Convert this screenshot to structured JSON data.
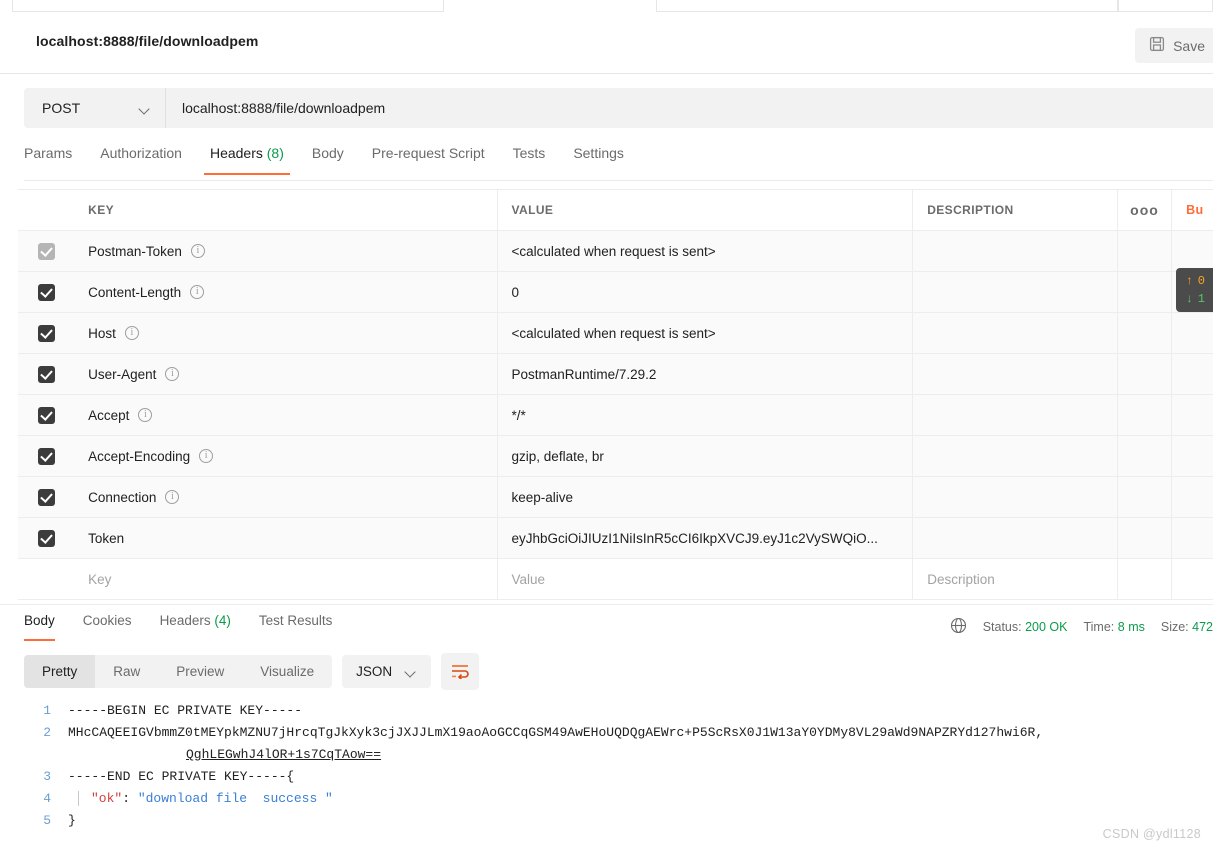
{
  "window": {
    "request_name": "localhost:8888/file/downloadpem",
    "save_label": "Save",
    "save_icon": "floppy-disk-icon"
  },
  "request": {
    "method": "POST",
    "url": "localhost:8888/file/downloadpem",
    "tabs": [
      {
        "label": "Params",
        "count": "",
        "active": false
      },
      {
        "label": "Authorization",
        "count": "",
        "active": false
      },
      {
        "label": "Headers",
        "count": "(8)",
        "active": true
      },
      {
        "label": "Body",
        "count": "",
        "active": false
      },
      {
        "label": "Pre-request Script",
        "count": "",
        "active": false
      },
      {
        "label": "Tests",
        "count": "",
        "active": false
      },
      {
        "label": "Settings",
        "count": "",
        "active": false
      }
    ]
  },
  "headers_table": {
    "columns": {
      "key": "KEY",
      "value": "VALUE",
      "description": "DESCRIPTION",
      "more_icon": "ooo",
      "bulk_edit": "Bu"
    },
    "placeholders": {
      "key": "Key",
      "value": "Value",
      "description": "Description"
    },
    "rows": [
      {
        "checked": true,
        "disabled": true,
        "key": "Postman-Token",
        "info": true,
        "value": "<calculated when request is sent>",
        "description": ""
      },
      {
        "checked": true,
        "disabled": false,
        "key": "Content-Length",
        "info": true,
        "value": "0",
        "description": ""
      },
      {
        "checked": true,
        "disabled": false,
        "key": "Host",
        "info": true,
        "value": "<calculated when request is sent>",
        "description": ""
      },
      {
        "checked": true,
        "disabled": false,
        "key": "User-Agent",
        "info": true,
        "value": "PostmanRuntime/7.29.2",
        "description": ""
      },
      {
        "checked": true,
        "disabled": false,
        "key": "Accept",
        "info": true,
        "value": "*/*",
        "description": ""
      },
      {
        "checked": true,
        "disabled": false,
        "key": "Accept-Encoding",
        "info": true,
        "value": "gzip, deflate, br",
        "description": ""
      },
      {
        "checked": true,
        "disabled": false,
        "key": "Connection",
        "info": true,
        "value": "keep-alive",
        "description": ""
      },
      {
        "checked": true,
        "disabled": false,
        "key": "Token",
        "info": false,
        "value": "eyJhbGciOiJIUzI1NiIsInR5cCI6IkpXVCJ9.eyJ1c2VySWQiO...",
        "description": ""
      }
    ]
  },
  "network_badge": {
    "upload_icon": "arrow-up-icon",
    "upload_value": "0",
    "download_icon": "arrow-down-icon",
    "download_value": "1"
  },
  "response": {
    "tabs": [
      {
        "label": "Body",
        "count": "",
        "active": true
      },
      {
        "label": "Cookies",
        "count": "",
        "active": false
      },
      {
        "label": "Headers",
        "count": "(4)",
        "active": false
      },
      {
        "label": "Test Results",
        "count": "",
        "active": false
      }
    ],
    "globe_icon": "globe-icon",
    "status_label": "Status:",
    "status_value": "200 OK",
    "time_label": "Time:",
    "time_value": "8 ms",
    "size_label": "Size:",
    "size_value": "472",
    "view_modes": [
      {
        "label": "Pretty",
        "active": true
      },
      {
        "label": "Raw",
        "active": false
      },
      {
        "label": "Preview",
        "active": false
      },
      {
        "label": "Visualize",
        "active": false
      }
    ],
    "format": "JSON",
    "wrap_icon": "word-wrap-icon",
    "body_lines": [
      {
        "num": "1",
        "segments": [
          {
            "text": "-----BEGIN EC PRIVATE KEY-----",
            "style": "plain"
          }
        ]
      },
      {
        "num": "2",
        "segments": [
          {
            "text": "MHcCAQEEIGVbmmZ0tMEYpkMZNU7jHrcqTgJkXyk3cjJXJJLmX19aoAoGCCqGSM49AwEHoUQDQgAEWrc+P5ScRsX0J1W13aY0YDMy8VL29aWd9NAPZRYd127hwi6R,",
            "style": "plain"
          }
        ]
      },
      {
        "num": "",
        "continuation": true,
        "segments": [
          {
            "text": "QghLEGwhJ4lOR+1s7CqTAow==",
            "style": "underline"
          }
        ]
      },
      {
        "num": "3",
        "segments": [
          {
            "text": "-----END EC PRIVATE KEY-----{",
            "style": "plain"
          }
        ]
      },
      {
        "num": "4",
        "fold": true,
        "segments": [
          {
            "text": "\"ok\"",
            "style": "key"
          },
          {
            "text": ": ",
            "style": "plain"
          },
          {
            "text": "\"download file  success \"",
            "style": "value"
          }
        ]
      },
      {
        "num": "5",
        "segments": [
          {
            "text": "}",
            "style": "plain"
          }
        ]
      }
    ]
  },
  "watermark": "CSDN @ydl1128"
}
